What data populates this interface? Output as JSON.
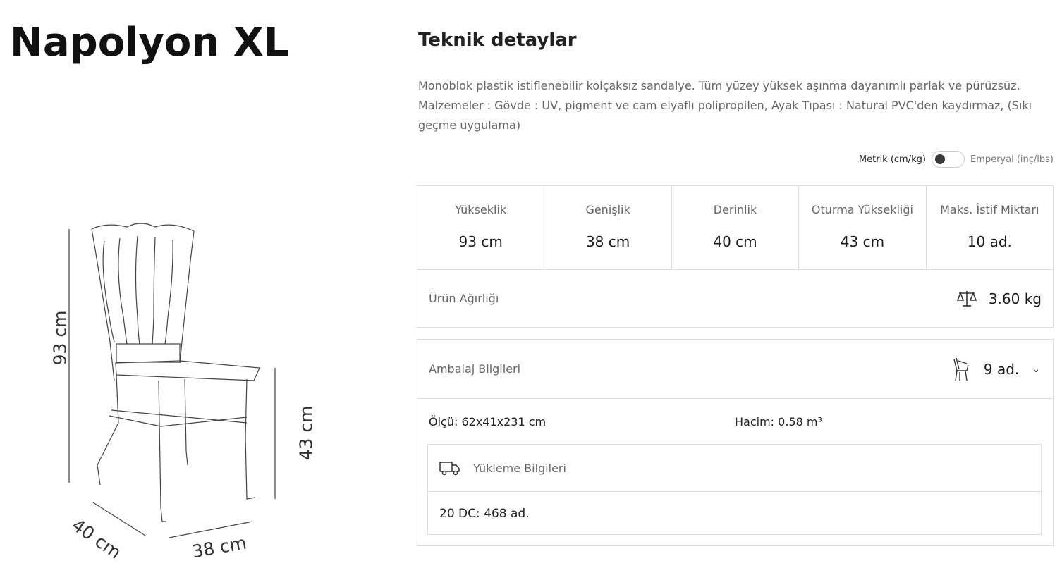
{
  "product": {
    "title": "Napolyon XL"
  },
  "dimensions": {
    "height": "93 cm",
    "seat": "43 cm",
    "depth": "40 cm",
    "width": "38 cm"
  },
  "tech": {
    "title": "Teknik detaylar",
    "description": "Monoblok plastik istiflenebilir kolçaksız sandalye. Tüm yüzey yüksek aşınma dayanımlı parlak ve pürüzsüz. Malzemeler : Gövde : UV, pigment ve cam elyaflı polipropilen, Ayak Tıpası : Natural PVC'den kaydırmaz, (Sıkı geçme uygulama)"
  },
  "units": {
    "metric": "Metrik (cm/kg)",
    "imperial": "Emperyal (inç/lbs)"
  },
  "specs": [
    {
      "label": "Yükseklik",
      "value": "93 cm"
    },
    {
      "label": "Genişlik",
      "value": "38 cm"
    },
    {
      "label": "Derinlik",
      "value": "40 cm"
    },
    {
      "label": "Oturma Yüksekliği",
      "value": "43 cm"
    },
    {
      "label": "Maks. İstif Miktarı",
      "value": "10 ad."
    }
  ],
  "weight": {
    "label": "Ürün Ağırlığı",
    "value": "3.60 kg",
    "icon": "scale-icon"
  },
  "packaging": {
    "label": "Ambalaj Bilgileri",
    "value": "9 ad.",
    "icon": "stacked-chair-icon",
    "measure": "Ölçü: 62x41x231 cm",
    "volume": "Hacim: 0.58 m³"
  },
  "loading": {
    "title": "Yükleme Bilgileri",
    "icon": "truck-icon",
    "value": "20 DC: 468 ad."
  },
  "colors": {
    "border": "#dddddd",
    "muted_text": "#666666",
    "text": "#1a1a1a"
  }
}
